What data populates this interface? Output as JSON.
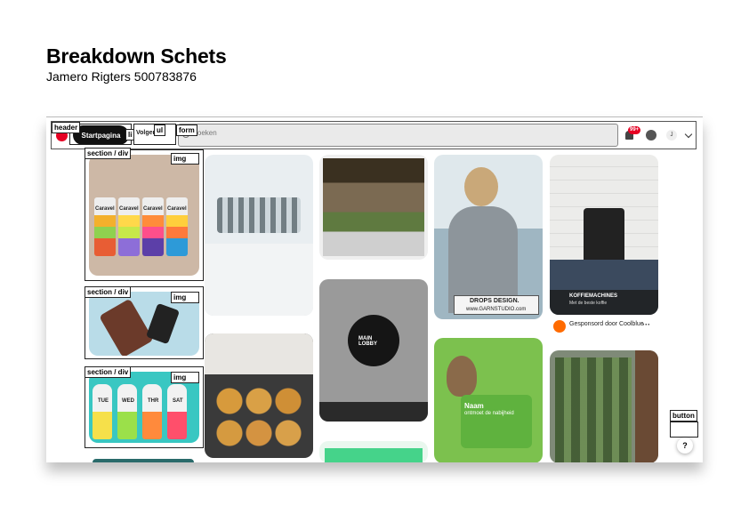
{
  "document": {
    "title": "Breakdown Schets",
    "author": "Jamero Rigters  500783876"
  },
  "header": {
    "home_label": "Startpagina",
    "following_label": "Volgend",
    "search_placeholder": "Zoeken",
    "notification_count": "99+",
    "avatar_initial": "J"
  },
  "annotations": {
    "header": "header",
    "li": "li",
    "ul": "ul",
    "form": "form",
    "section": "section / div",
    "img": "img",
    "button": "button"
  },
  "pins": {
    "drops_text": "DROPS DESIGN.",
    "drops_url": "www.GARNSTUDIO.com",
    "coffee_brand": "KOFFIEMACHINES",
    "coffee_sub": "Met de beste koffie",
    "sponsored": "Gesponsord door Coolblue",
    "more": "···",
    "lobby": "MAIN LOBBY",
    "card_title": "Naam",
    "card_sub": "ontmoet de nabijheid",
    "can_1": "Caravel",
    "can_2": "Caravel",
    "can_3": "Caravel",
    "can_4": "Caravel",
    "bottle_1": "TUE",
    "bottle_2": "WED",
    "bottle_3": "THR",
    "bottle_4": "SAT"
  },
  "help_label": "?",
  "colors": {
    "brand": "#e60023",
    "dark_pill": "#111111"
  }
}
